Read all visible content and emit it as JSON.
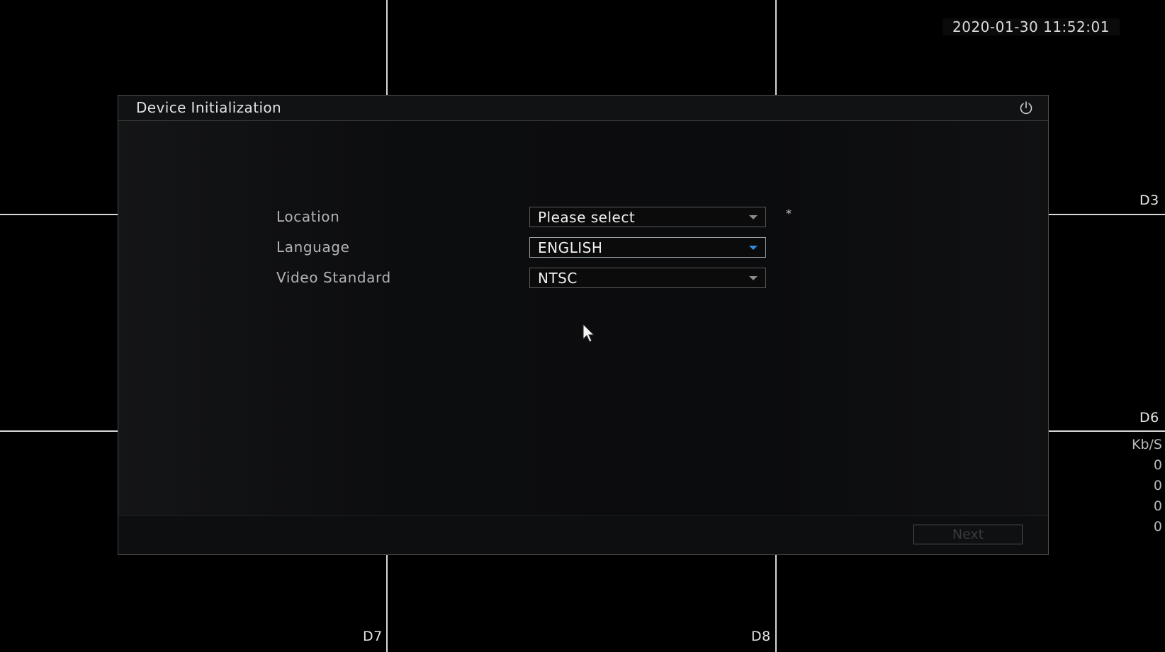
{
  "screen": {
    "timestamp": "2020-01-30 11:52:01",
    "channels": {
      "d3": "D3",
      "d6": "D6",
      "d7": "D7",
      "d8": "D8"
    },
    "bitrate": {
      "unit": "Kb/S",
      "values": [
        "0",
        "0",
        "0",
        "0"
      ]
    }
  },
  "dialog": {
    "title": "Device Initialization",
    "power_icon": "power-icon",
    "fields": [
      {
        "label": "Location",
        "value": "Please select",
        "required_mark": "*"
      },
      {
        "label": "Language",
        "value": "ENGLISH"
      },
      {
        "label": "Video Standard",
        "value": "NTSC"
      }
    ],
    "next_label": "Next"
  },
  "colors": {
    "accent": "#2f8ee0",
    "background": "#000000",
    "grid_line": "#d8d8d8"
  }
}
